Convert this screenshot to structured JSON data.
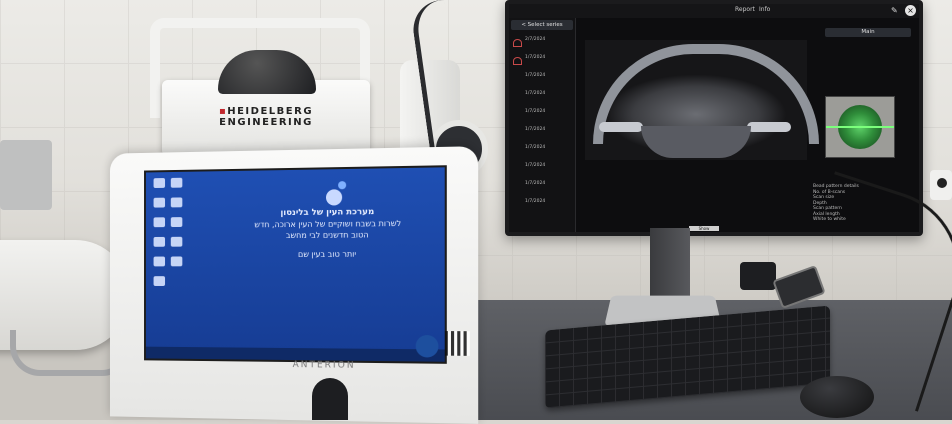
{
  "tablet": {
    "brand_line1": "HEIDELBERG",
    "brand_line2": "ENGINEERING",
    "model": "ANTERION",
    "welcome_title": "מערכת העין של בלינסון",
    "welcome_text": "לשרות בשבח ושוקיים של העין ארוכה, חדש הטוב חדשנים לבי מחשב",
    "signature": "יותר טוב בעין שם",
    "icons": [
      "desktop-icon",
      "desktop-icon",
      "desktop-icon",
      "desktop-icon",
      "desktop-icon",
      "desktop-icon",
      "desktop-icon",
      "desktop-icon",
      "desktop-icon",
      "desktop-icon",
      "desktop-icon"
    ]
  },
  "monitor": {
    "toolbar_items": [
      "Report",
      "Info"
    ],
    "side_header": "< Select series",
    "series_dates": [
      "2/7/2024",
      "1/7/2024",
      "1/7/2024",
      "1/7/2024",
      "1/7/2024",
      "1/7/2024",
      "1/7/2024",
      "1/7/2024",
      "1/7/2024",
      "1/7/2024"
    ],
    "right_header": "Main",
    "bottom_label": "Show",
    "info_lines": [
      "Bead pattern details",
      "No. of B-scans",
      "Scan size",
      "Depth",
      "Scan pattern",
      "Axial length",
      "White to white"
    ]
  },
  "colors": {
    "screen_blue": "#1f4fb3",
    "oct_green": "#5fd36a",
    "brand_red": "#c1272d"
  }
}
